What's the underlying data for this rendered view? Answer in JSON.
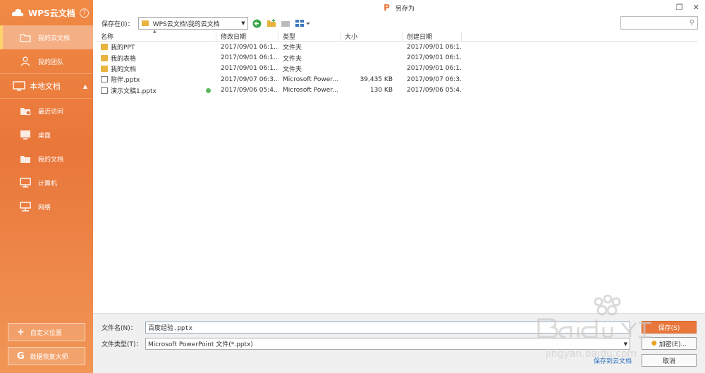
{
  "sidebar": {
    "brand": "WPS云文档",
    "help": "?",
    "cloud_items": [
      {
        "label": "我的云文档",
        "active": true
      },
      {
        "label": "我的团队",
        "active": false
      }
    ],
    "local_section": "本地文档",
    "local_items": [
      {
        "label": "最近访问"
      },
      {
        "label": "桌面"
      },
      {
        "label": "我的文档"
      },
      {
        "label": "计算机"
      },
      {
        "label": "网络"
      }
    ],
    "custom_location": "自定义位置",
    "data_recovery": "数据恢复大师"
  },
  "titlebar": {
    "title": "另存为"
  },
  "toolbar": {
    "save_in_label": "保存在(I)：",
    "path": "WPS云文档\\我的云文档"
  },
  "list": {
    "columns": [
      "名称",
      "修改日期",
      "类型",
      "大小",
      "创建日期"
    ],
    "rows": [
      {
        "name": "我的PPT",
        "modified": "2017/09/01 06:1...",
        "type": "文件夹",
        "size": "",
        "created": "2017/09/01 06:1...",
        "kind": "folder",
        "synced": false
      },
      {
        "name": "我的表格",
        "modified": "2017/09/01 06:1...",
        "type": "文件夹",
        "size": "",
        "created": "2017/09/01 06:1...",
        "kind": "folder",
        "synced": false
      },
      {
        "name": "我的文档",
        "modified": "2017/09/01 06:1...",
        "type": "文件夹",
        "size": "",
        "created": "2017/09/01 06:1...",
        "kind": "folder",
        "synced": false
      },
      {
        "name": "陪伴.pptx",
        "modified": "2017/09/07 06:3...",
        "type": "Microsoft Power...",
        "size": "39,435 KB",
        "created": "2017/09/07 06:3...",
        "kind": "file",
        "synced": false
      },
      {
        "name": "演示文稿1.pptx",
        "modified": "2017/09/06 05:4...",
        "type": "Microsoft Power...",
        "size": "130 KB",
        "created": "2017/09/06 05:4...",
        "kind": "file",
        "synced": true
      }
    ]
  },
  "bottom": {
    "filename_label": "文件名(N)：",
    "filename_value": "百度经验.pptx",
    "filetype_label": "文件类型(T)：",
    "filetype_value": "Microsoft PowerPoint 文件(*.pptx)",
    "save_button": "保存(S)",
    "encrypt_button": "加密(E)...",
    "save_to_cloud": "保存到云文档",
    "cancel_button": "取消"
  },
  "colors": {
    "accent": "#e9763a",
    "sidebar_top": "#f08a45",
    "link": "#2a6ebb"
  }
}
